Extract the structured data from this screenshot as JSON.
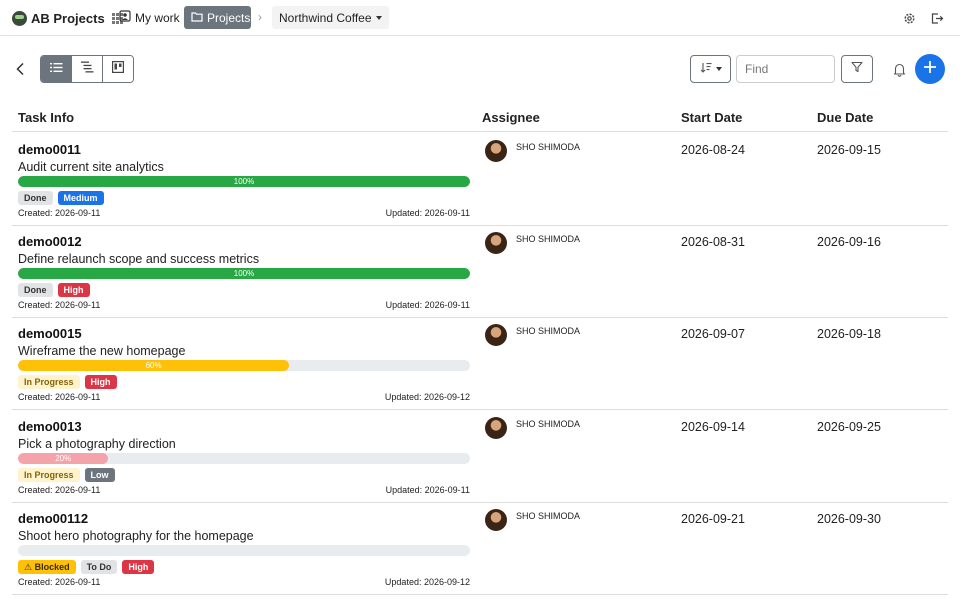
{
  "header": {
    "brand": "AB Projects",
    "nav_mywork": "My work",
    "nav_projects": "Projects",
    "breadcrumb_sep": "›",
    "project_name": "Northwind Coffee"
  },
  "toolbar": {
    "find_placeholder": "Find"
  },
  "table": {
    "columns": {
      "task": "Task Info",
      "assignee": "Assignee",
      "start": "Start Date",
      "due": "Due Date"
    },
    "rows": [
      {
        "id": "demo0011",
        "title": "Audit current site analytics",
        "progress": 100,
        "progress_label": "100%",
        "progress_color": "#28a745",
        "badges": [
          {
            "label": "Done",
            "type": "done"
          },
          {
            "label": "Medium",
            "type": "medium"
          }
        ],
        "created": "Created: 2026-09-11",
        "updated": "Updated: 2026-09-11",
        "assignee": "SHO SHIMODA",
        "start": "2026-08-24",
        "due": "2026-09-15"
      },
      {
        "id": "demo0012",
        "title": "Define relaunch scope and success metrics",
        "progress": 100,
        "progress_label": "100%",
        "progress_color": "#28a745",
        "badges": [
          {
            "label": "Done",
            "type": "done"
          },
          {
            "label": "High",
            "type": "high"
          }
        ],
        "created": "Created: 2026-09-11",
        "updated": "Updated: 2026-09-11",
        "assignee": "SHO SHIMODA",
        "start": "2026-08-31",
        "due": "2026-09-16"
      },
      {
        "id": "demo0015",
        "title": "Wireframe the new homepage",
        "progress": 60,
        "progress_label": "60%",
        "progress_color": "#ffc107",
        "badges": [
          {
            "label": "In Progress",
            "type": "inprogress"
          },
          {
            "label": "High",
            "type": "high"
          }
        ],
        "created": "Created: 2026-09-11",
        "updated": "Updated: 2026-09-12",
        "assignee": "SHO SHIMODA",
        "start": "2026-09-07",
        "due": "2026-09-18"
      },
      {
        "id": "demo0013",
        "title": "Pick a photography direction",
        "progress": 20,
        "progress_label": "20%",
        "progress_color": "#f5a3ab",
        "badges": [
          {
            "label": "In Progress",
            "type": "inprogress"
          },
          {
            "label": "Low",
            "type": "low"
          }
        ],
        "created": "Created: 2026-09-11",
        "updated": "Updated: 2026-09-11",
        "assignee": "SHO SHIMODA",
        "start": "2026-09-14",
        "due": "2026-09-25"
      },
      {
        "id": "demo00112",
        "title": "Shoot hero photography for the homepage",
        "progress": 0,
        "progress_label": "",
        "progress_color": "#e9ecef",
        "badges": [
          {
            "label": "⚠ Blocked",
            "type": "blocked"
          },
          {
            "label": "To Do",
            "type": "todo"
          },
          {
            "label": "High",
            "type": "high"
          }
        ],
        "created": "Created: 2026-09-11",
        "updated": "Updated: 2026-09-12",
        "assignee": "SHO SHIMODA",
        "start": "2026-09-21",
        "due": "2026-09-30"
      }
    ]
  },
  "colors": {
    "primary": "#1b73e8",
    "secondary": "#6c757d",
    "success": "#28a745",
    "warning": "#ffc107",
    "danger": "#dc3545"
  },
  "icons": [
    "brand-logo-icon",
    "apps-grid-icon",
    "mywork-icon",
    "folder-icon",
    "settings-icon",
    "logout-icon",
    "back-icon",
    "list-view-icon",
    "tree-view-icon",
    "board-view-icon",
    "sort-icon",
    "filter-icon",
    "bell-icon",
    "plus-icon"
  ]
}
